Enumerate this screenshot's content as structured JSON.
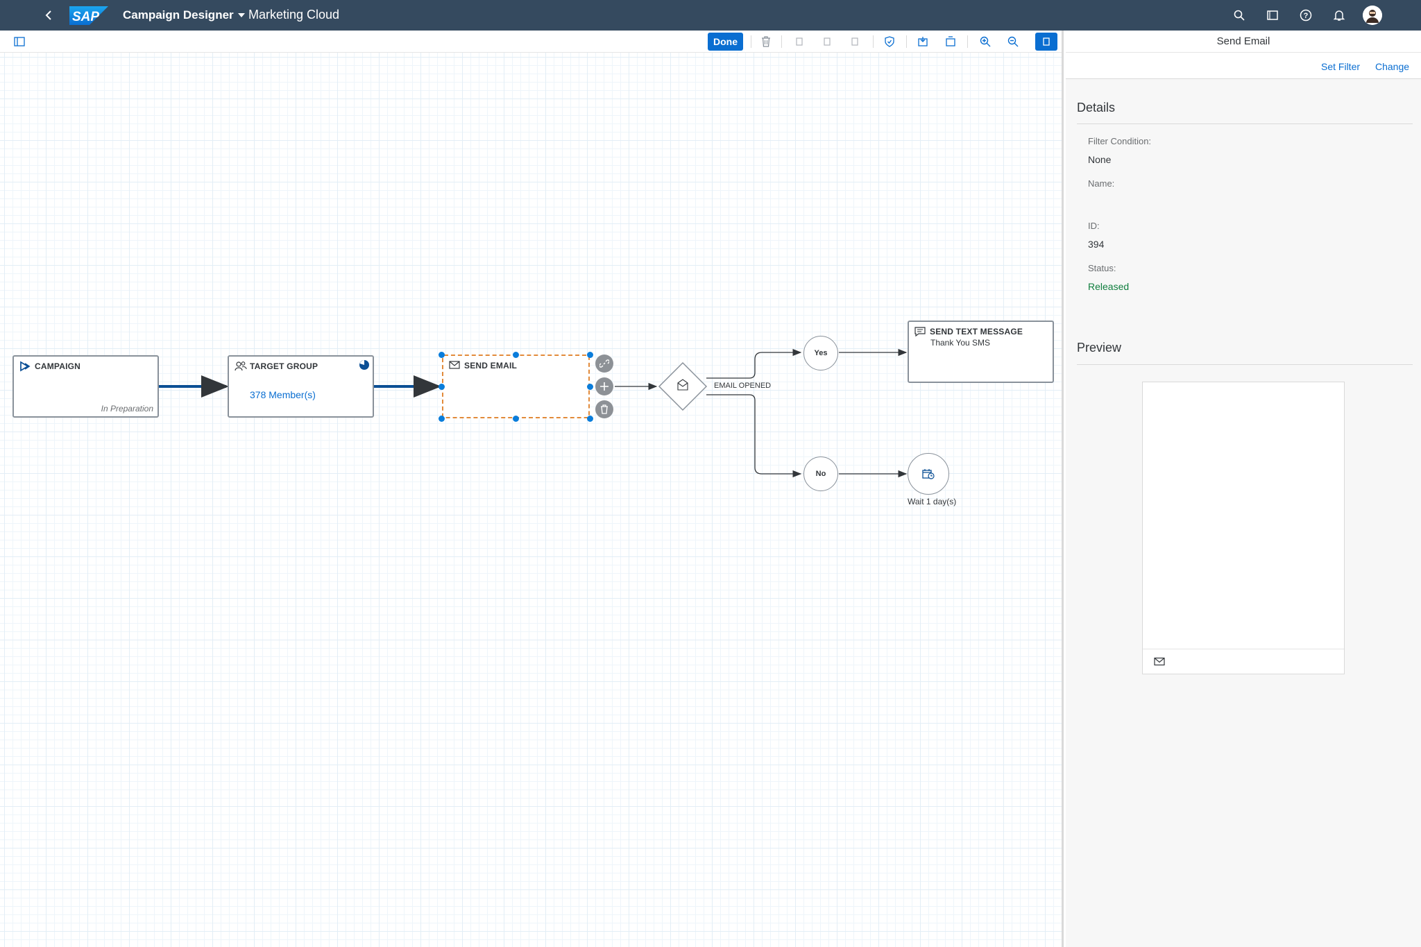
{
  "shell": {
    "app_title": "Campaign Designer",
    "app_subtitle": "Marketing Cloud",
    "logo_text": "SAP"
  },
  "toolbar": {
    "done_label": "Done"
  },
  "canvas": {
    "nodes": {
      "campaign": {
        "title": "CAMPAIGN",
        "state": "In Preparation"
      },
      "target_group": {
        "title": "TARGET GROUP",
        "members": "378 Member(s)"
      },
      "send_email": {
        "title": "SEND EMAIL"
      },
      "send_text": {
        "title": "SEND TEXT MESSAGE",
        "subtitle": "Thank You SMS"
      }
    },
    "decision_label": "EMAIL OPENED",
    "branch_yes": "Yes",
    "branch_no": "No",
    "wait_label": "Wait 1 day(s)"
  },
  "panel": {
    "title": "Send Email",
    "set_filter": "Set Filter",
    "change": "Change",
    "details_title": "Details",
    "fields": {
      "filter_condition_label": "Filter Condition:",
      "filter_condition_value": "None",
      "name_label": "Name:",
      "name_value": "",
      "id_label": "ID:",
      "id_value": "394",
      "status_label": "Status:",
      "status_value": "Released"
    },
    "preview_title": "Preview"
  },
  "colors": {
    "shell_bg": "#354a5f",
    "accent": "#0a6ed1",
    "selection": "#e28a3a",
    "status_released": "#107e3e"
  }
}
